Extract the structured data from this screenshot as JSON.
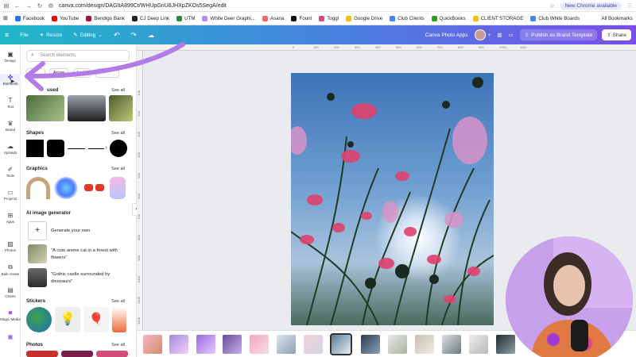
{
  "browser": {
    "url": "canva.com/design/DAGItA899Ct/WHUpGnU8JHXpZKOs5SegA/edit",
    "update_label": "New Chrome available"
  },
  "bookmarks": [
    {
      "label": "Facebook",
      "color": "#1877f2"
    },
    {
      "label": "YouTube",
      "color": "#ff0000"
    },
    {
      "label": "Bendigo Bank",
      "color": "#a1163b"
    },
    {
      "label": "CJ Deep Link",
      "color": "#222222"
    },
    {
      "label": "UTM",
      "color": "#2b8a3e"
    },
    {
      "label": "White Deer Graphi...",
      "color": "#b88ae8"
    },
    {
      "label": "Asana",
      "color": "#f06a6a"
    },
    {
      "label": "Fount",
      "color": "#111111"
    },
    {
      "label": "Toggl",
      "color": "#e0457b"
    },
    {
      "label": "Google Drive",
      "color": "#fbbc04"
    },
    {
      "label": "Club Clients",
      "color": "#4285f4"
    },
    {
      "label": "QuickBooks",
      "color": "#2ca01c"
    },
    {
      "label": "CLIENT STORAGE",
      "color": "#fbbc04"
    },
    {
      "label": "Club White Boards",
      "color": "#4285f4"
    }
  ],
  "all_bookmarks": "All Bookmarks",
  "topbar": {
    "file": "File",
    "resize": "Resize",
    "editing": "Editing",
    "app_name": "Canva Photo Apps",
    "publish": "Publish as Brand Template",
    "share": "Share"
  },
  "rail": [
    {
      "label": "Design"
    },
    {
      "label": "Elements"
    },
    {
      "label": "Text"
    },
    {
      "label": "Brand"
    },
    {
      "label": "Uploads"
    },
    {
      "label": "Tools"
    },
    {
      "label": "Projects"
    },
    {
      "label": "Apps"
    },
    {
      "label": "Photos"
    },
    {
      "label": "Bulk create"
    },
    {
      "label": "Charts"
    },
    {
      "label": "Magic Media"
    }
  ],
  "panel": {
    "search_placeholder": "Search elements",
    "chips": [
      "Arrow",
      "Logo"
    ],
    "recent_title": "used",
    "see_all": "See all",
    "shapes": "Shapes",
    "graphics": "Graphics",
    "ai_title": "AI image generator",
    "generate": "Generate your own",
    "prompt1": "\"A cute anime cat in a forest with flowers\"",
    "prompt2": "\"Gothic castle surrounded by dinosaurs\"",
    "stickers": "Stickers",
    "photos": "Photos"
  },
  "ruler_top": [
    "0",
    "100",
    "200",
    "300",
    "400",
    "500",
    "600",
    "700",
    "800",
    "900",
    "1000",
    "1100"
  ],
  "ruler_left": [
    "100",
    "200",
    "300",
    "400",
    "500",
    "600",
    "700",
    "800",
    "900",
    "1000",
    "1100",
    "1200",
    "1300"
  ],
  "colors": {
    "accent": "#7a4fe8",
    "teal": "#1fb7c7"
  }
}
